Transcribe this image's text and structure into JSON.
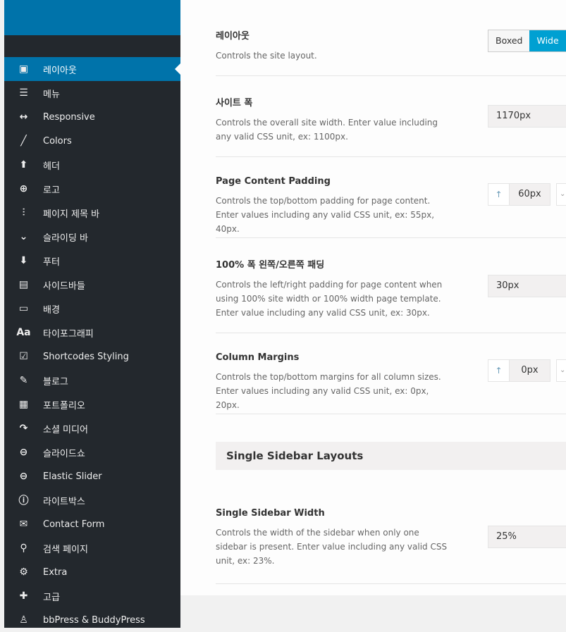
{
  "sidebar": {
    "items": [
      {
        "label": "레이아웃",
        "icon": "layout-icon",
        "glyph": "▣",
        "active": true
      },
      {
        "label": "메뉴",
        "icon": "menu-icon",
        "glyph": "☰"
      },
      {
        "label": "Responsive",
        "icon": "arrows-horizontal-icon",
        "glyph": "↔"
      },
      {
        "label": "Colors",
        "icon": "brush-icon",
        "glyph": "╱"
      },
      {
        "label": "헤더",
        "icon": "arrow-up-icon",
        "glyph": "⬆"
      },
      {
        "label": "로고",
        "icon": "plus-circle-icon",
        "glyph": "⊕"
      },
      {
        "label": "페이지 제목 바",
        "icon": "sliders-icon",
        "glyph": "⫶"
      },
      {
        "label": "슬라이딩 바",
        "icon": "chevron-down-icon",
        "glyph": "⌄"
      },
      {
        "label": "푸터",
        "icon": "arrow-down-icon",
        "glyph": "⬇"
      },
      {
        "label": "사이드바들",
        "icon": "sidebar-icon",
        "glyph": "▤"
      },
      {
        "label": "배경",
        "icon": "monitor-icon",
        "glyph": "▭"
      },
      {
        "label": "타이포그래피",
        "icon": "typography-icon",
        "glyph": "Aa"
      },
      {
        "label": "Shortcodes Styling",
        "icon": "checkbox-icon",
        "glyph": "☑"
      },
      {
        "label": "블로그",
        "icon": "edit-icon",
        "glyph": "✎"
      },
      {
        "label": "포트폴리오",
        "icon": "grid-icon",
        "glyph": "▦"
      },
      {
        "label": "소셜 미디어",
        "icon": "share-icon",
        "glyph": "↷"
      },
      {
        "label": "슬라이드쇼",
        "icon": "slideshow-icon",
        "glyph": "⊖"
      },
      {
        "label": "Elastic Slider",
        "icon": "slider-icon",
        "glyph": "⊖"
      },
      {
        "label": "라이트박스",
        "icon": "info-icon",
        "glyph": "ⓘ"
      },
      {
        "label": "Contact Form",
        "icon": "envelope-icon",
        "glyph": "✉"
      },
      {
        "label": "검색 페이지",
        "icon": "search-icon",
        "glyph": "⚲"
      },
      {
        "label": "Extra",
        "icon": "gears-icon",
        "glyph": "⚙"
      },
      {
        "label": "고급",
        "icon": "puzzle-icon",
        "glyph": "✚"
      },
      {
        "label": "bbPress & BuddyPress",
        "icon": "user-icon",
        "glyph": "♙"
      }
    ]
  },
  "main": {
    "layout": {
      "title": "레이아웃",
      "desc": "Controls the site layout.",
      "options": [
        "Boxed",
        "Wide"
      ],
      "selected": "Wide"
    },
    "site_width": {
      "title": "사이트 폭",
      "desc": "Controls the overall site width. Enter value including any valid CSS unit, ex: 1100px.",
      "value": "1170px"
    },
    "page_padding": {
      "title": "Page Content Padding",
      "desc": "Controls the top/bottom padding for page content. Enter values including any valid CSS unit, ex: 55px, 40px.",
      "value": "60px"
    },
    "hundred_padding": {
      "title": "100% 폭 왼쪽/오른쪽 패딩",
      "desc": "Controls the left/right padding for page content when using 100% site width or 100% width page template. Enter value including any valid CSS unit, ex: 30px.",
      "value": "30px"
    },
    "column_margins": {
      "title": "Column Margins",
      "desc": "Controls the top/bottom margins for all column sizes. Enter values including any valid CSS unit, ex: 0px, 20px.",
      "value": "0px"
    },
    "group_title": "Single Sidebar Layouts",
    "sidebar_width": {
      "title": "Single Sidebar Width",
      "desc": "Controls the width of the sidebar when only one sidebar is present. Enter value including any valid CSS unit, ex: 23%.",
      "value": "25%"
    }
  },
  "colors": {
    "brand": "#0073aa",
    "sidebar": "#23282d",
    "toggle_on": "#00a0d2"
  }
}
